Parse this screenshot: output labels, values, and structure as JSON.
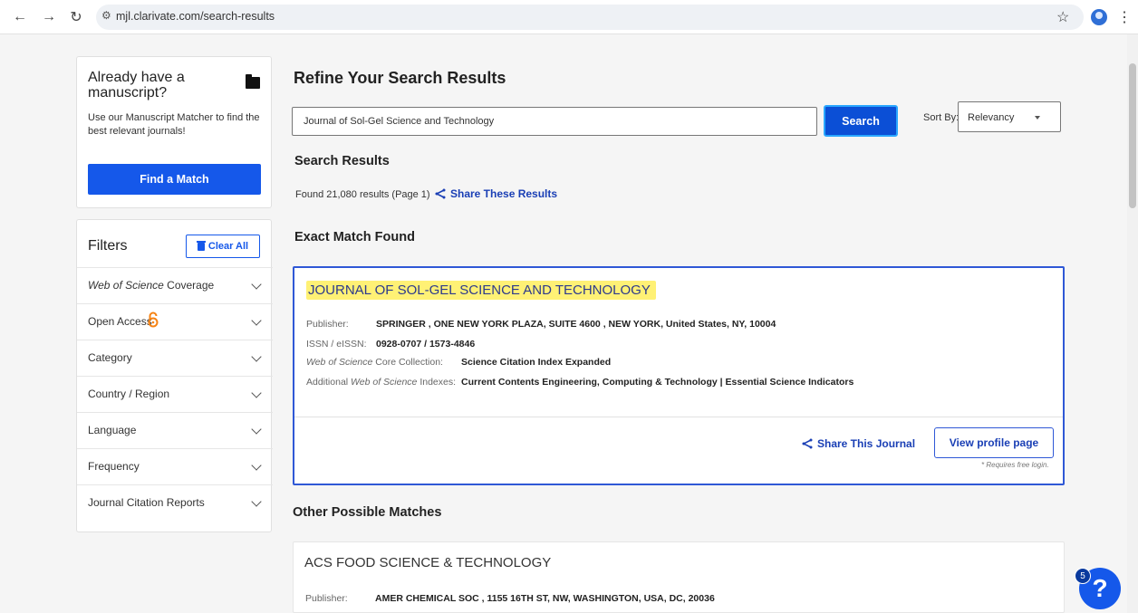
{
  "browser": {
    "url": "mjl.clarivate.com/search-results"
  },
  "manuscript": {
    "title": "Already have a manuscript?",
    "description": "Use our Manuscript Matcher to find the best relevant journals!",
    "button": "Find a Match"
  },
  "filters": {
    "title": "Filters",
    "clear_label": "Clear All",
    "items": [
      {
        "label_em": "Web of Science",
        "label": " Coverage"
      },
      {
        "label_em": "",
        "label": "Open Access"
      },
      {
        "label_em": "",
        "label": "Category"
      },
      {
        "label_em": "",
        "label": "Country / Region"
      },
      {
        "label_em": "",
        "label": "Language"
      },
      {
        "label_em": "",
        "label": "Frequency"
      },
      {
        "label_em": "",
        "label": "Journal Citation Reports"
      }
    ]
  },
  "main": {
    "heading": "Refine Your Search Results",
    "search_value": "Journal of Sol-Gel Science and Technology",
    "search_button": "Search",
    "sort_label": "Sort By:",
    "sort_value": "Relevancy",
    "results_heading": "Search Results",
    "found_text": "Found 21,080 results (Page 1)",
    "share_results": "Share These Results",
    "exact_heading": "Exact Match Found",
    "other_heading": "Other Possible Matches"
  },
  "exact_match": {
    "title": "JOURNAL OF SOL-GEL SCIENCE AND TECHNOLOGY",
    "publisher_label": "Publisher:",
    "publisher": "SPRINGER , ONE NEW YORK PLAZA, SUITE 4600 , NEW YORK, United States, NY, 10004",
    "issn_label": "ISSN / eISSN:",
    "issn": "0928-0707 / 1573-4846",
    "core_label_em": "Web of Science",
    "core_label": " Core Collection:",
    "core": "Science Citation Index Expanded",
    "additional_label_pre": "Additional ",
    "additional_label_em": "Web of Science",
    "additional_label_post": " Indexes:",
    "additional": "Current Contents Engineering, Computing & Technology | Essential Science Indicators",
    "share_journal": "Share This Journal",
    "profile_button": "View profile page",
    "requires_login": "* Requires free login."
  },
  "other_match": {
    "title": "ACS FOOD SCIENCE & TECHNOLOGY",
    "publisher_label": "Publisher:",
    "publisher": "AMER CHEMICAL SOC , 1155 16TH ST, NW, WASHINGTON, USA, DC, 20036"
  },
  "help": {
    "icon": "?",
    "badge": "5"
  },
  "colors": {
    "primary": "#1558ea",
    "highlight": "#fff175",
    "open_access": "#f68212"
  }
}
